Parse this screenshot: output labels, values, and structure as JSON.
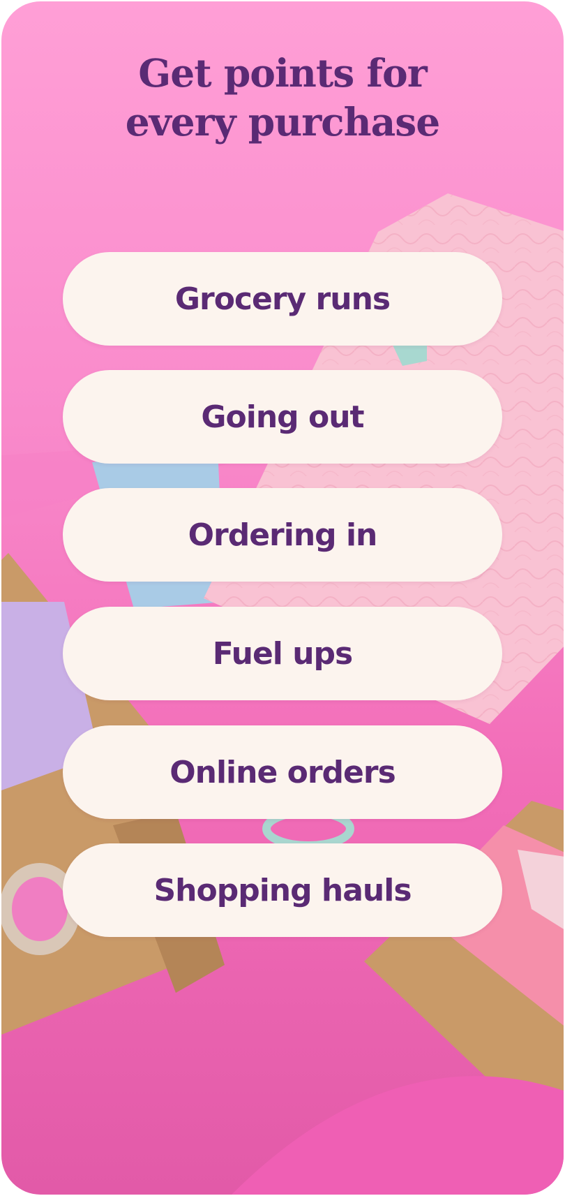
{
  "header": {
    "title_line1": "Get points for",
    "title_line2": "every purchase"
  },
  "categories": [
    {
      "label": "Grocery runs"
    },
    {
      "label": "Going out"
    },
    {
      "label": "Ordering in"
    },
    {
      "label": "Fuel ups"
    },
    {
      "label": "Online orders"
    },
    {
      "label": "Shopping hauls"
    }
  ],
  "colors": {
    "background_pink": "#f98acb",
    "headline_purple": "#5a2a74",
    "pill_cream": "#fcf4ee",
    "mailer_pink": "#f9c2d3",
    "cardboard": "#c99a68"
  }
}
